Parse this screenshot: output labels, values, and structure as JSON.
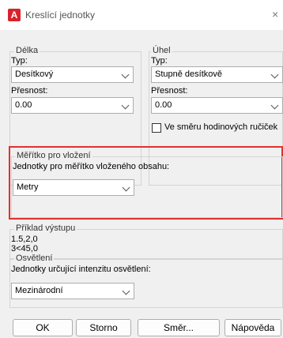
{
  "window": {
    "title": "Kreslící jednotky",
    "icon_letter": "A",
    "close_glyph": "×"
  },
  "length": {
    "legend": "Délka",
    "type_label": "Typ:",
    "type_value": "Desítkový",
    "precision_label": "Přesnost:",
    "precision_value": "0.00"
  },
  "angle": {
    "legend": "Úhel",
    "type_label": "Typ:",
    "type_value": "Stupně desítkově",
    "precision_label": "Přesnost:",
    "precision_value": "0.00",
    "clockwise_label": "Ve směru hodinových ručiček",
    "clockwise_checked": false
  },
  "insertion_scale": {
    "legend": "Měřítko pro vložení",
    "units_label": "Jednotky pro měřítko vloženého obsahu:",
    "units_value": "Metry"
  },
  "sample_output": {
    "legend": "Příklad výstupu",
    "line1": "1.5,2,0",
    "line2": "3<45,0"
  },
  "lighting": {
    "legend": "Osvětlení",
    "units_label": "Jednotky určující intenzitu osvětlení:",
    "units_value": "Mezinárodní"
  },
  "buttons": {
    "ok": "OK",
    "cancel": "Storno",
    "direction": "Směr...",
    "help": "Nápověda"
  },
  "colors": {
    "highlight": "#e0312f",
    "app_icon": "#d8232a"
  }
}
